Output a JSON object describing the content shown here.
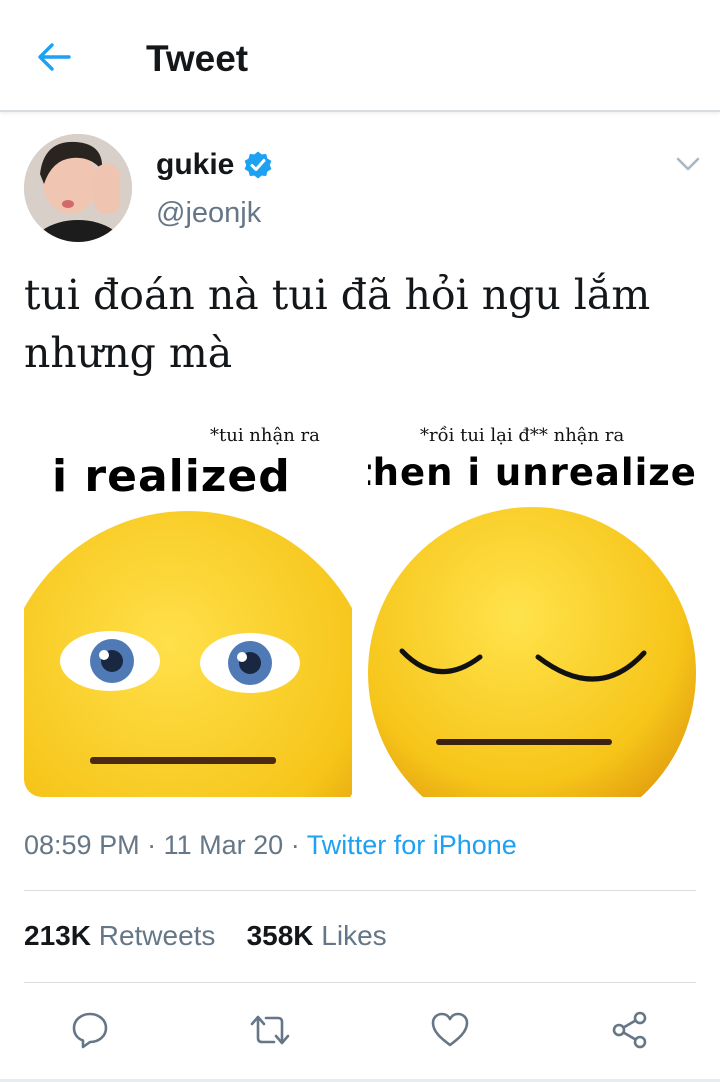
{
  "header": {
    "title": "Tweet"
  },
  "tweet": {
    "author": {
      "name": "gukie",
      "handle": "@jeonjk",
      "verified": true
    },
    "text_lines": [
      "tui đoán nà tui đã hỏi ngu lắm",
      "nhưng mà"
    ],
    "media": [
      {
        "caption_small": "*tui nhận ra",
        "caption_big": "i realized",
        "emoji": "wide-eyed-face"
      },
      {
        "caption_small": "*rồi tui lại đ** nhận ra",
        "caption_big": "then i unrealized",
        "emoji": "closed-eyes-face"
      }
    ],
    "time": "08:59 PM",
    "date": "11 Mar 20",
    "source": "Twitter for iPhone",
    "separator": "·",
    "stats": {
      "retweets_count": "213K",
      "retweets_label": "Retweets",
      "likes_count": "358K",
      "likes_label": "Likes"
    }
  },
  "actions": [
    "reply-icon",
    "retweet-icon",
    "like-icon",
    "share-icon"
  ],
  "colors": {
    "link": "#1da1f2",
    "secondary": "#657786",
    "text": "#14171a",
    "emoji": "#f6c51a"
  }
}
